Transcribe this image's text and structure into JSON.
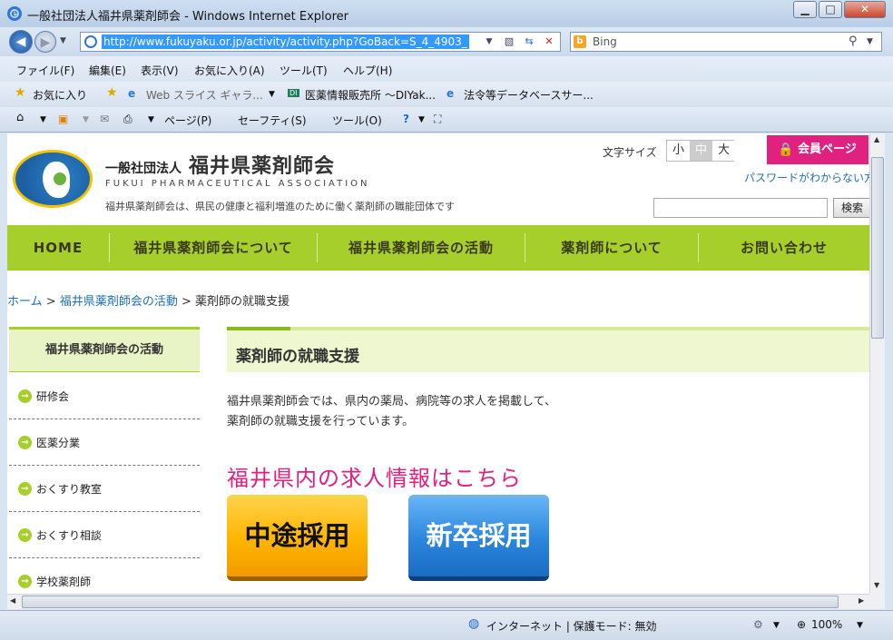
{
  "window": {
    "title": "一般社団法人福井県薬剤師会 - Windows Internet Explorer",
    "controls": {
      "minimize": "▁",
      "maximize": "□",
      "close": "✕"
    }
  },
  "address": {
    "url": "http://www.fukuyaku.or.jp/activity/activity.php?GoBack=S_4_4903_",
    "search_engine": "Bing"
  },
  "menu": [
    "ファイル(F)",
    "編集(E)",
    "表示(V)",
    "お気に入り(A)",
    "ツール(T)",
    "ヘルプ(H)"
  ],
  "favorites": {
    "label": "お気に入り",
    "items": [
      "Web スライス ギャラ...",
      "医薬情報販売所 〜DIYak...",
      "法令等データベースサー..."
    ]
  },
  "commands": [
    "ページ(P)",
    "セーフティ(S)",
    "ツール(O)"
  ],
  "site": {
    "org_prefix": "一般社団法人",
    "org_name": "福井県薬剤師会",
    "org_en": "FUKUI PHARMACEUTICAL ASSOCIATION",
    "tagline": "福井県薬剤師会は、県民の健康と福利増進のために働く薬剤師の職能団体です",
    "font_size_label": "文字サイズ",
    "font_sizes": [
      "小",
      "中",
      "大"
    ],
    "member_button": "会員ページ",
    "password_link": "パスワードがわからない方",
    "search_button": "検索"
  },
  "nav": [
    "HOME",
    "福井県薬剤師会について",
    "福井県薬剤師会の活動",
    "薬剤師について",
    "お問い合わせ"
  ],
  "breadcrumb": {
    "home": "ホーム",
    "sep": ">",
    "parent": "福井県薬剤師会の活動",
    "current": "薬剤師の就職支援"
  },
  "sidebar": {
    "heading": "福井県薬剤師会の活動",
    "items": [
      "研修会",
      "医薬分業",
      "おくすり教室",
      "おくすり相談",
      "学校薬剤師"
    ]
  },
  "content": {
    "title": "薬剤師の就職支援",
    "intro_line1": "福井県薬剤師会では、県内の薬局、病院等の求人を掲載して、",
    "intro_line2": "薬剤師の就職支援を行っています。",
    "jobs_heading": "福井県内の求人情報はこちら",
    "btn_midcareer": "中途採用",
    "btn_newgrad": "新卒採用"
  },
  "status": {
    "zone": "インターネット | 保護モード: 無効",
    "zoom": "100%"
  },
  "colors": {
    "accent_green": "#a7cf2b",
    "pink": "#e0217f",
    "link_blue": "#1d6fb8"
  }
}
